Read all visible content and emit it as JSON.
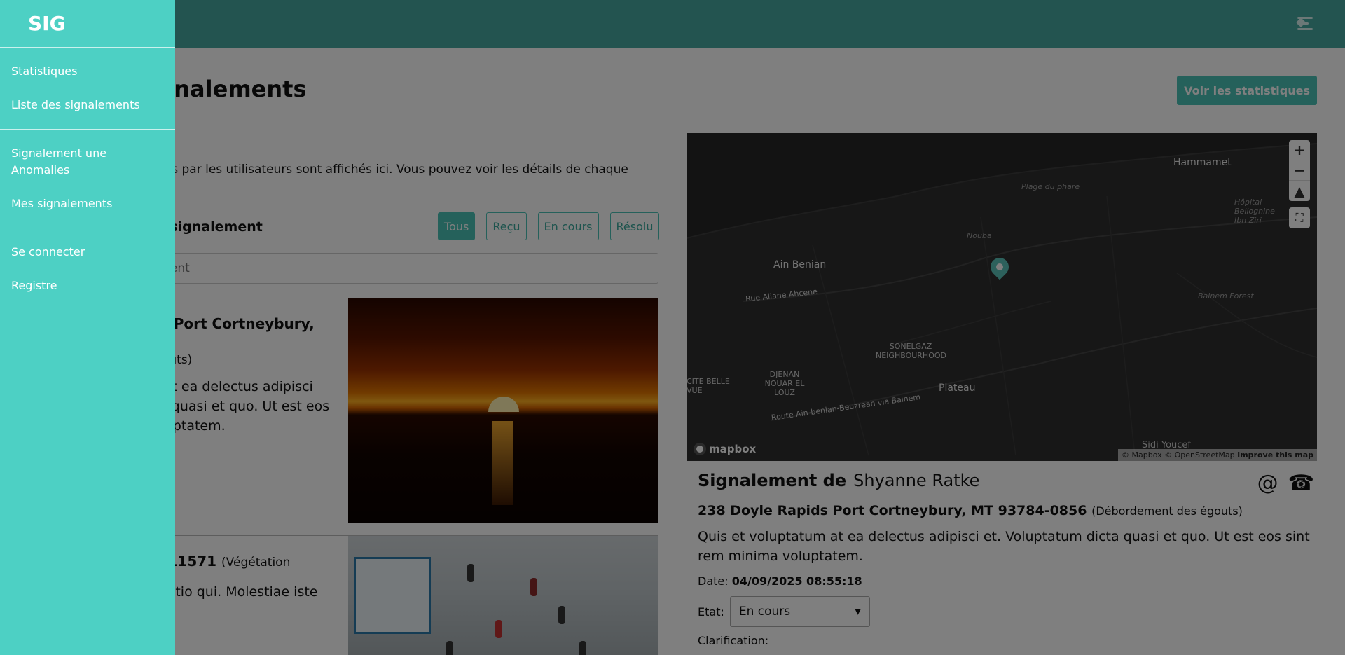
{
  "app": {
    "brand": "SIG"
  },
  "sidebar": {
    "group1": [
      {
        "label": "Statistiques"
      },
      {
        "label": "Liste des signalements"
      }
    ],
    "group2": [
      {
        "label": "Signalement une Anomalies"
      },
      {
        "label": "Mes signalements"
      }
    ],
    "group3": [
      {
        "label": "Se connecter"
      },
      {
        "label": "Registre"
      }
    ]
  },
  "header": {
    "menu_icon": "menu-collapse-icon"
  },
  "page": {
    "title": "Liste des signalements",
    "stats_button": "Voir les statistiques",
    "intro": "Les signalements effectués par les utilisateurs sont affichés ici. Vous pouvez voir les détails de chaque signalement ci-dessus.",
    "filter_label": "Filtrer par statut de signalement",
    "filters": [
      {
        "label": "Tous",
        "active": true
      },
      {
        "label": "Reçu",
        "active": false
      },
      {
        "label": "En cours",
        "active": false
      },
      {
        "label": "Résolu",
        "active": false
      }
    ],
    "search_placeholder": "Rechercher un signalement"
  },
  "cards": [
    {
      "address": "238 Doyle Rapids Port Cortneybury, MT",
      "type": "(Débordement des égouts)",
      "description": "Quis et voluptatum at ea delectus adipisci et. Voluptatum dicta quasi et quo. Ut est eos sint rem minima voluptatem.",
      "date": "04/09/2025 08:55:18"
    },
    {
      "address": "… Apt. 817 … AK 11571",
      "type": "(Végétation",
      "description": "… accusantium … dictio qui. Molestiae iste"
    }
  ],
  "map": {
    "labels": {
      "hammamet": "Hammamet",
      "plage": "Plage du phare",
      "hopital": "Hôpital Belloghine Ibn Ziri",
      "nouba": "Nouba",
      "ain_benian": "Ain Benian",
      "rue_aliane": "Rue Aliane Ahcene",
      "bainem": "Bainem Forest",
      "sonelgaz": "SONELGAZ NEIGHBOURHOOD",
      "djenan": "DJENAN NOUAR EL LOUZ",
      "cite_belle": "CITE BELLE VUE",
      "plateau": "Plateau",
      "route": "Route Ain-benian-Beuzreah via Bainem",
      "sidi": "Sidi Youcef"
    },
    "logo": "mapbox",
    "attribution": "© Mapbox © OpenStreetMap",
    "improve": "Improve this map",
    "zoom_in": "+",
    "zoom_out": "−"
  },
  "detail": {
    "title": "Signalement de",
    "name": "Shyanne Ratke",
    "address": "238 Doyle Rapids Port Cortneybury, MT 93784-0856",
    "type": "(Débordement des égouts)",
    "description": "Quis et voluptatum at ea delectus adipisci et. Voluptatum dicta quasi et quo. Ut est eos sint rem minima voluptatem.",
    "date_label": "Date:",
    "date": "04/09/2025 08:55:18",
    "etat_label": "Etat:",
    "etat_value": "En cours",
    "clarification_label": "Clarification:"
  }
}
